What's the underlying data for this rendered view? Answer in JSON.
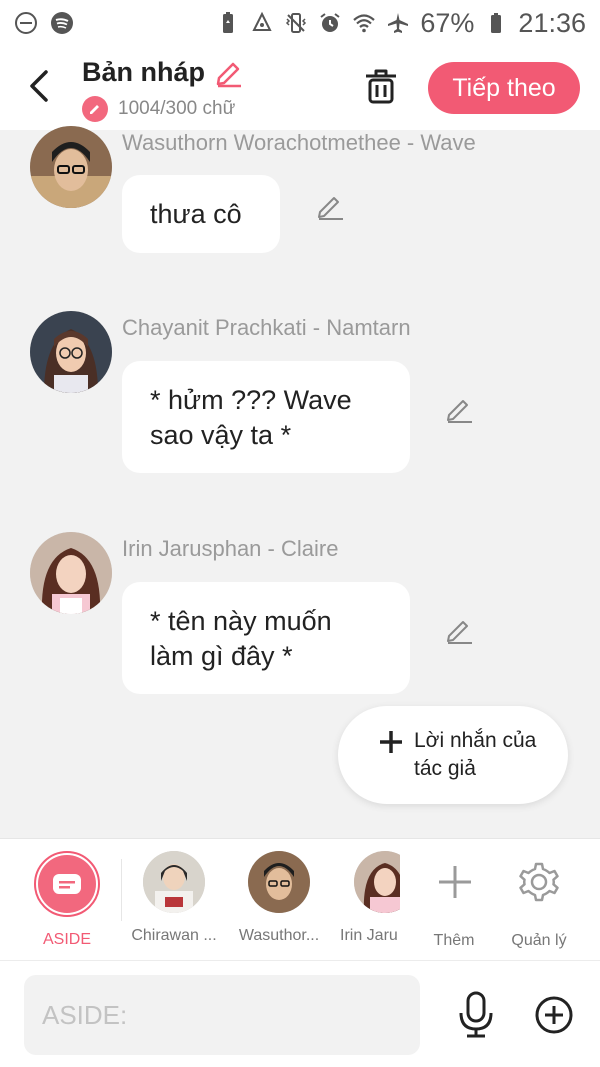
{
  "status_bar": {
    "battery": "67%",
    "time": "21:36",
    "icons": [
      "do-not-disturb-icon",
      "spotify-icon",
      "battery-saver-icon",
      "recycle-icon",
      "vibrate-icon",
      "alarm-icon",
      "wifi-icon",
      "airplane-icon",
      "battery-icon"
    ]
  },
  "header": {
    "title": "Bản nháp",
    "count": "1004/300 chữ",
    "next_label": "Tiếp theo",
    "accent": "#f25a74"
  },
  "messages": [
    {
      "sender": "Wasuthorn Worachotmethee - Wave",
      "text": "thưa cô"
    },
    {
      "sender": "Chayanit Prachkati - Namtarn",
      "text": "* hửm ??? Wave sao vậy ta *"
    },
    {
      "sender": "Irin Jarusphan  - Claire",
      "text": "* tên này muốn làm gì đây *"
    }
  ],
  "author_note": {
    "label": "Lời nhắn của tác giả"
  },
  "characters": {
    "aside_label": "ASIDE",
    "items": [
      {
        "label": "Chirawan ..."
      },
      {
        "label": "Wasuthor..."
      },
      {
        "label": "Irin Jaru"
      }
    ],
    "add_label": "Thêm",
    "manage_label": "Quản lý"
  },
  "input": {
    "placeholder": "ASIDE:"
  }
}
